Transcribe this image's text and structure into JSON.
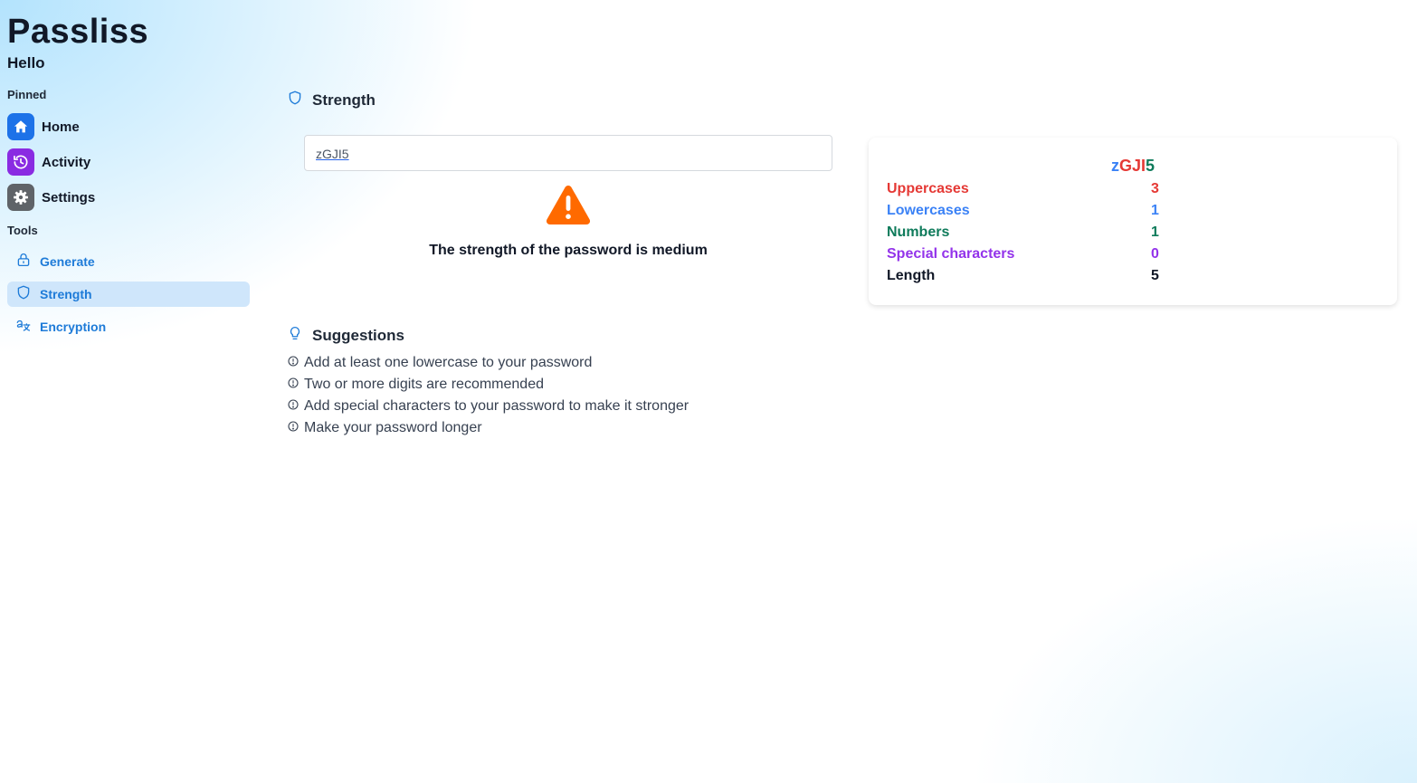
{
  "app": {
    "title": "Passliss",
    "greeting": "Hello"
  },
  "sidebar": {
    "pinned_label": "Pinned",
    "pinned": [
      {
        "label": "Home",
        "icon": "home-icon",
        "color": "#1d72e8"
      },
      {
        "label": "Activity",
        "icon": "history-icon",
        "color": "#8a2be2"
      },
      {
        "label": "Settings",
        "icon": "gear-icon",
        "color": "#5f6368"
      }
    ],
    "tools_label": "Tools",
    "tools": [
      {
        "label": "Generate",
        "icon": "lock-icon",
        "active": false
      },
      {
        "label": "Strength",
        "icon": "shield-icon",
        "active": true
      },
      {
        "label": "Encryption",
        "icon": "translate-icon",
        "active": false
      }
    ]
  },
  "strength": {
    "title": "Strength",
    "password": "zGJI5",
    "message": "The strength of the password is medium",
    "warning_color": "#ff6a00"
  },
  "stats": {
    "password_parts": [
      {
        "text": "z",
        "color": "#3b82f6"
      },
      {
        "text": "GJI",
        "color": "#e53935"
      },
      {
        "text": "5",
        "color": "#0f7b5b"
      }
    ],
    "rows": [
      {
        "label": "Uppercases",
        "value": "3",
        "color": "#e53935"
      },
      {
        "label": "Lowercases",
        "value": "1",
        "color": "#3b82f6"
      },
      {
        "label": "Numbers",
        "value": "1",
        "color": "#0f7b5b"
      },
      {
        "label": "Special characters",
        "value": "0",
        "color": "#9333ea"
      },
      {
        "label": "Length",
        "value": "5",
        "color": "#111827"
      }
    ]
  },
  "suggestions": {
    "title": "Suggestions",
    "items": [
      "Add at least one lowercase to your password",
      "Two or more digits are recommended",
      "Add special characters to your password to make it stronger",
      "Make your password longer"
    ]
  },
  "colors": {
    "accent": "#1e7bd8",
    "active_bg": "#cfe6fb"
  }
}
